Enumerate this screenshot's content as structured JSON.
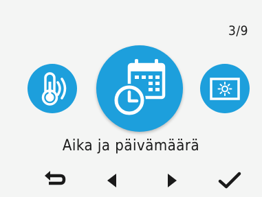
{
  "header": {
    "page_counter": "3/9"
  },
  "menu": {
    "selected_label": "Aika ja päivämäärä",
    "items": [
      {
        "icon": "thermometer-icon"
      },
      {
        "icon": "calendar-clock-icon"
      },
      {
        "icon": "screen-brightness-icon"
      }
    ]
  },
  "nav": {
    "buttons": [
      {
        "icon": "back-icon"
      },
      {
        "icon": "previous-icon"
      },
      {
        "icon": "next-icon"
      },
      {
        "icon": "confirm-icon"
      }
    ]
  },
  "colors": {
    "accent": "#1d9fdc",
    "background": "#f4f5f4",
    "text": "#1a1a1a"
  }
}
